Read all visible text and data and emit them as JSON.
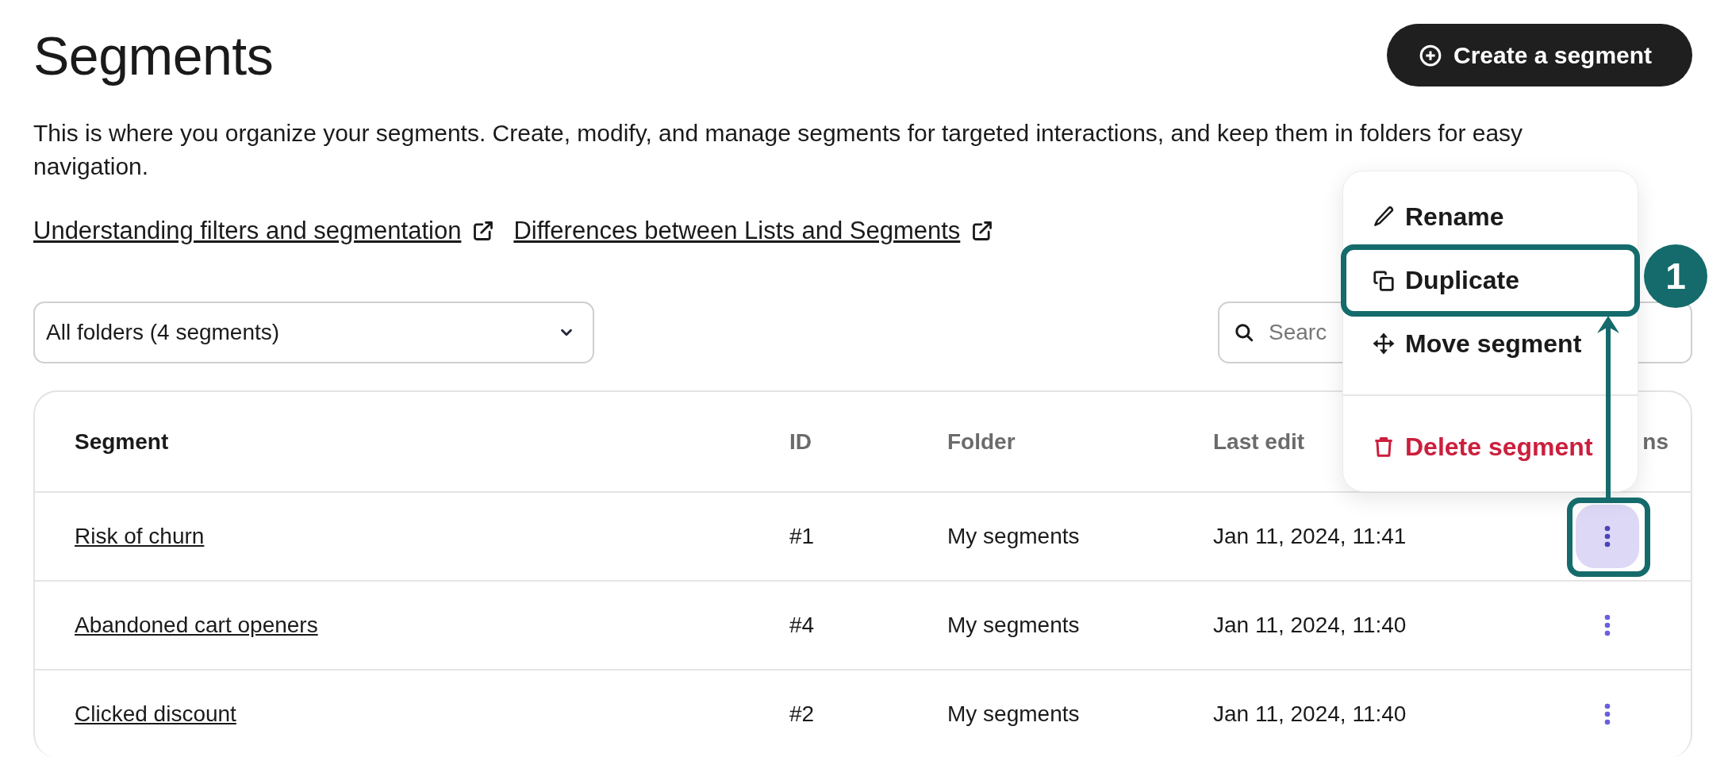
{
  "page": {
    "title": "Segments",
    "create_button": "Create a segment",
    "description": "This is where you organize your segments. Create, modify, and manage segments for targeted interactions, and keep them in folders for easy navigation."
  },
  "links": [
    "Understanding filters and segmentation",
    "Differences between Lists and Segments"
  ],
  "folder_select": {
    "value": "All folders (4 segments)"
  },
  "search": {
    "placeholder": "Searc"
  },
  "table": {
    "columns": [
      {
        "label": "Segment",
        "emphasis": true
      },
      {
        "label": "ID",
        "emphasis": false
      },
      {
        "label": "Folder",
        "emphasis": false
      },
      {
        "label": "Last edit",
        "emphasis": false
      },
      {
        "label": "ns",
        "emphasis": false
      }
    ],
    "rows": [
      {
        "name": "Risk of churn",
        "id": "#1",
        "folder": "My segments",
        "last_edit": "Jan 11, 2024, 11:41",
        "menu_open": true
      },
      {
        "name": "Abandoned cart openers",
        "id": "#4",
        "folder": "My segments",
        "last_edit": "Jan 11, 2024, 11:40",
        "menu_open": false
      },
      {
        "name": "Clicked discount",
        "id": "#2",
        "folder": "My segments",
        "last_edit": "Jan 11, 2024, 11:40",
        "menu_open": false
      }
    ]
  },
  "menu": {
    "items": [
      {
        "label": "Rename",
        "kind": "rename",
        "highlighted": false
      },
      {
        "label": "Duplicate",
        "kind": "duplicate",
        "highlighted": true
      },
      {
        "label": "Move segment",
        "kind": "move",
        "highlighted": false
      },
      {
        "label": "Delete segment",
        "kind": "delete",
        "highlighted": false
      }
    ]
  },
  "callout": {
    "label": "1"
  }
}
